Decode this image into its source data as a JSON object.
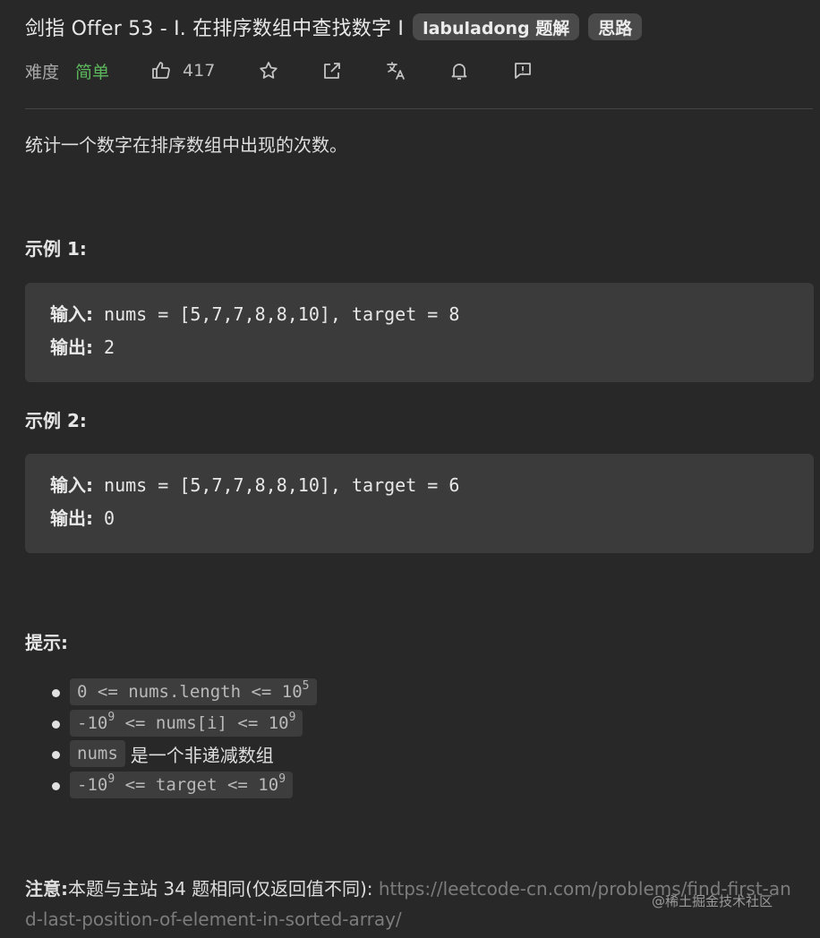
{
  "header": {
    "title": "剑指 Offer 53 - I. 在排序数组中查找数字 I",
    "tags": [
      "labuladong 题解",
      "思路"
    ]
  },
  "meta": {
    "difficulty_label": "难度",
    "difficulty_value": "简单",
    "likes": "417",
    "icons": [
      "thumbs-up-icon",
      "star-icon",
      "share-icon",
      "translate-icon",
      "bell-icon",
      "feedback-icon"
    ]
  },
  "problem": {
    "description": "统计一个数字在排序数组中出现的次数。",
    "examples": [
      {
        "title": "示例 1:",
        "input_label": "输入:",
        "input_value": " nums = [5,7,7,8,8,10], target = 8",
        "output_label": "输出:",
        "output_value": " 2"
      },
      {
        "title": "示例 2:",
        "input_label": "输入:",
        "input_value": " nums = [5,7,7,8,8,10], target = 6",
        "output_label": "输出:",
        "output_value": " 0"
      }
    ],
    "hints_title": "提示:",
    "hints": [
      {
        "code": "0 <= nums.length <= 10",
        "sup": "5",
        "code_tail": "",
        "text": ""
      },
      {
        "code": "-10",
        "sup": "9",
        "code_tail": " <= nums[i] <= 10",
        "sup2": "9",
        "text": ""
      },
      {
        "code": "nums",
        "sup": "",
        "code_tail": "",
        "text": "是一个非递减数组"
      },
      {
        "code": "-10",
        "sup": "9",
        "code_tail": " <= target <= 10",
        "sup2": "9",
        "text": ""
      }
    ],
    "note_label": "注意:",
    "note_text": "本题与主站 34 题相同(仅返回值不同):",
    "note_link": "https://leetcode-cn.com/problems/find-first-and-last-position-of-element-in-sorted-array/"
  },
  "watermark": "@稀土掘金技术社区",
  "colors": {
    "background": "#282828",
    "code_background": "#3b3b3b",
    "difficulty_easy": "#5cb85c",
    "tag_background": "#4a4a4a"
  }
}
